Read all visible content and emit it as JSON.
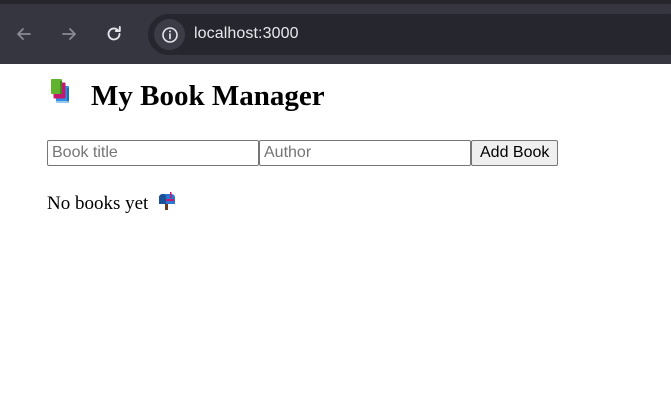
{
  "browser": {
    "url": "localhost:3000",
    "icons": {
      "back": "arrow-left-icon",
      "forward": "arrow-right-icon",
      "reload": "reload-icon",
      "site_info": "info-icon"
    }
  },
  "app": {
    "title": "My Book Manager",
    "title_icon": "books-icon",
    "form": {
      "title_placeholder": "Book title",
      "title_value": "",
      "author_placeholder": "Author",
      "author_value": "",
      "add_button_label": "Add Book"
    },
    "empty_message": "No books yet",
    "empty_icon": "mailbox-icon"
  },
  "colors": {
    "toolbar_bg": "#35363f",
    "address_bar_bg": "#26262e",
    "url_text": "#e8e8ec"
  }
}
